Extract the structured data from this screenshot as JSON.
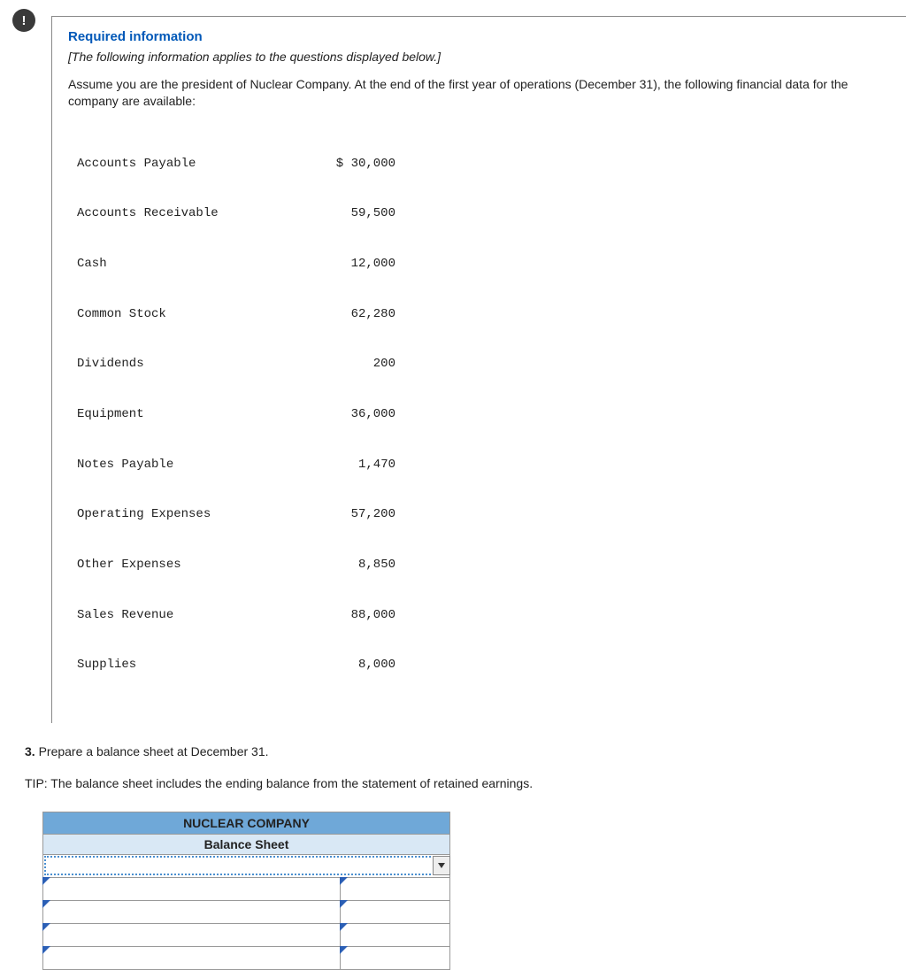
{
  "badge": "!",
  "heading": "Required information",
  "italic_note": "[The following information applies to the questions displayed below.]",
  "scenario": "Assume you are the president of Nuclear Company. At the end of the first year of operations (December 31), the following financial data for the company are available:",
  "fin_data": [
    {
      "label": "Accounts Payable",
      "value": "$ 30,000"
    },
    {
      "label": "Accounts Receivable",
      "value": "59,500"
    },
    {
      "label": "Cash",
      "value": "12,000"
    },
    {
      "label": "Common Stock",
      "value": "62,280"
    },
    {
      "label": "Dividends",
      "value": "200"
    },
    {
      "label": "Equipment",
      "value": "36,000"
    },
    {
      "label": "Notes Payable",
      "value": "1,470"
    },
    {
      "label": "Operating Expenses",
      "value": "57,200"
    },
    {
      "label": "Other Expenses",
      "value": "8,850"
    },
    {
      "label": "Sales Revenue",
      "value": "88,000"
    },
    {
      "label": "Supplies",
      "value": "8,000"
    }
  ],
  "question_number": "3.",
  "question_text": "Prepare a balance sheet at December 31.",
  "tip": "TIP: The balance sheet includes the ending balance from the statement of retained earnings.",
  "answer_header1": "NUCLEAR COMPANY",
  "answer_header2": "Balance Sheet"
}
